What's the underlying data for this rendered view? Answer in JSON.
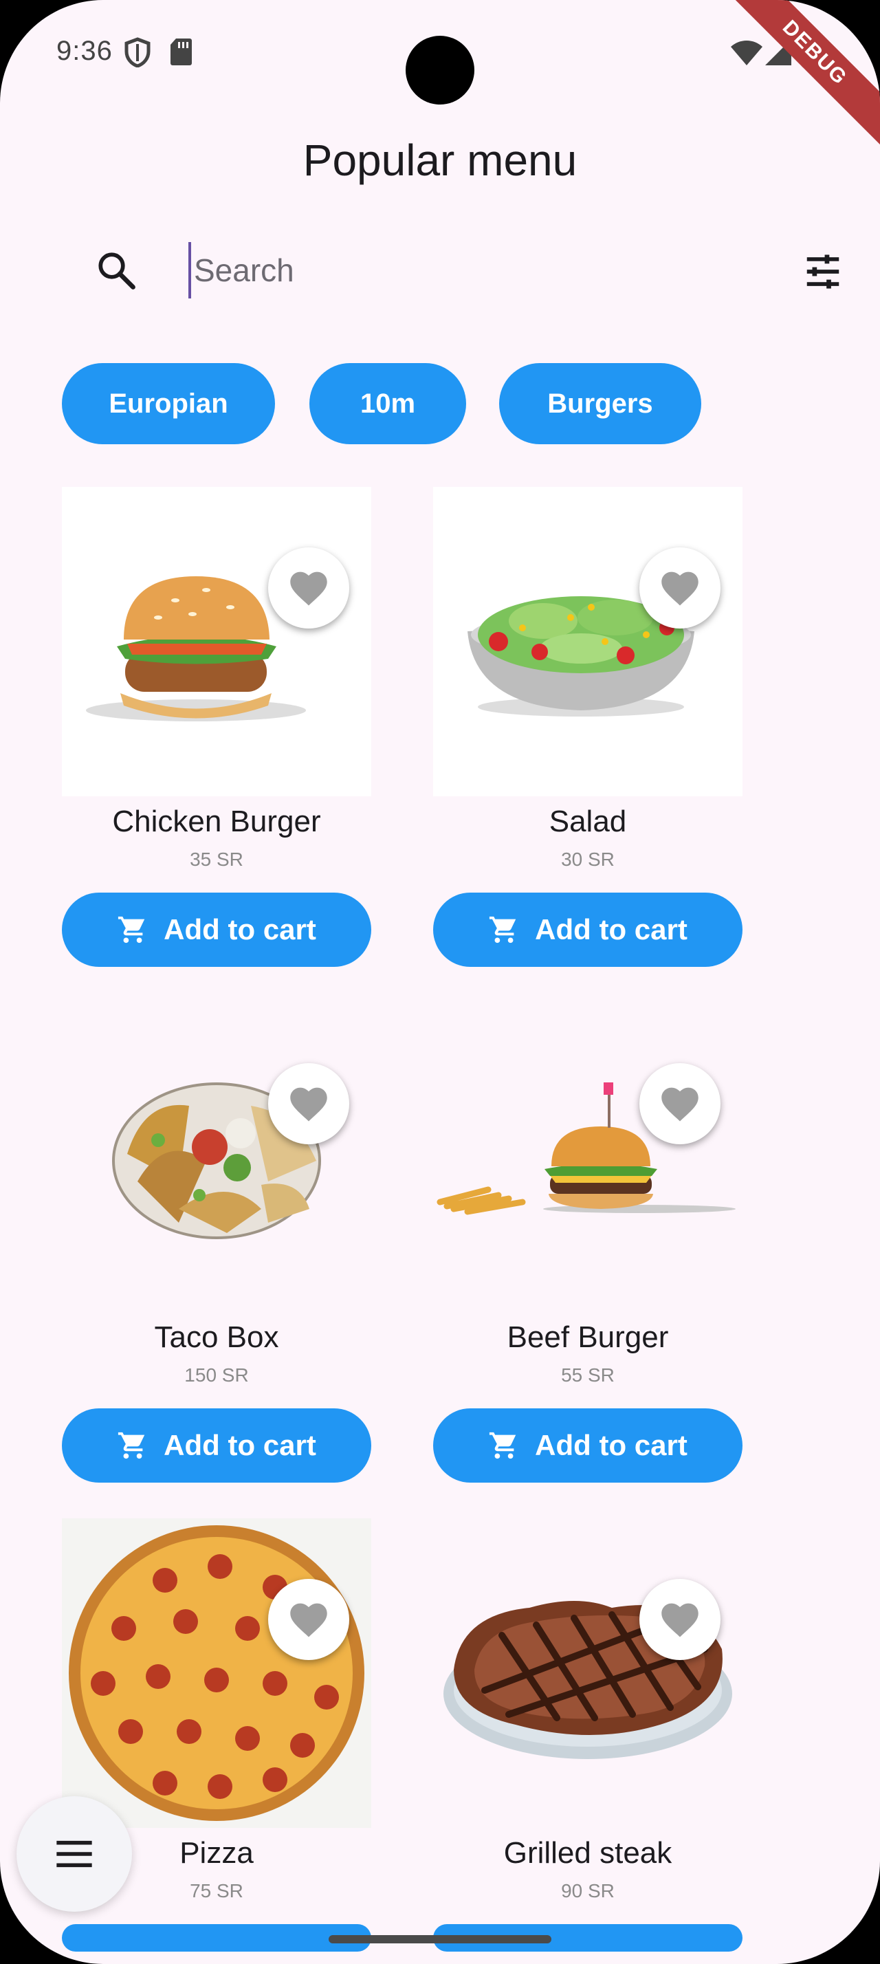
{
  "status_bar": {
    "time": "9:36",
    "icons": [
      "shield-icon",
      "sd-card-icon",
      "wifi-icon",
      "signal-icon",
      "battery-icon"
    ]
  },
  "debug_banner": "DEBUG",
  "page_title": "Popular menu",
  "search": {
    "placeholder": "Search",
    "value": ""
  },
  "chips": [
    "Europian",
    "10m",
    "Burgers"
  ],
  "cart_label": "Add to cart",
  "items": [
    {
      "name": "Chicken Burger",
      "price": "35 SR",
      "image": "chicken-burger"
    },
    {
      "name": "Salad",
      "price": "30 SR",
      "image": "salad"
    },
    {
      "name": "Taco Box",
      "price": "150 SR",
      "image": "taco-box"
    },
    {
      "name": "Beef Burger",
      "price": "55 SR",
      "image": "beef-burger"
    },
    {
      "name": "Pizza",
      "price": "75 SR",
      "image": "pizza"
    },
    {
      "name": "Grilled steak",
      "price": "90 SR",
      "image": "grilled-steak"
    }
  ],
  "colors": {
    "background": "#FDF5FB",
    "accent": "#2196F3",
    "favorite_icon": "#9E9E9E",
    "cursor": "#6750A4"
  }
}
